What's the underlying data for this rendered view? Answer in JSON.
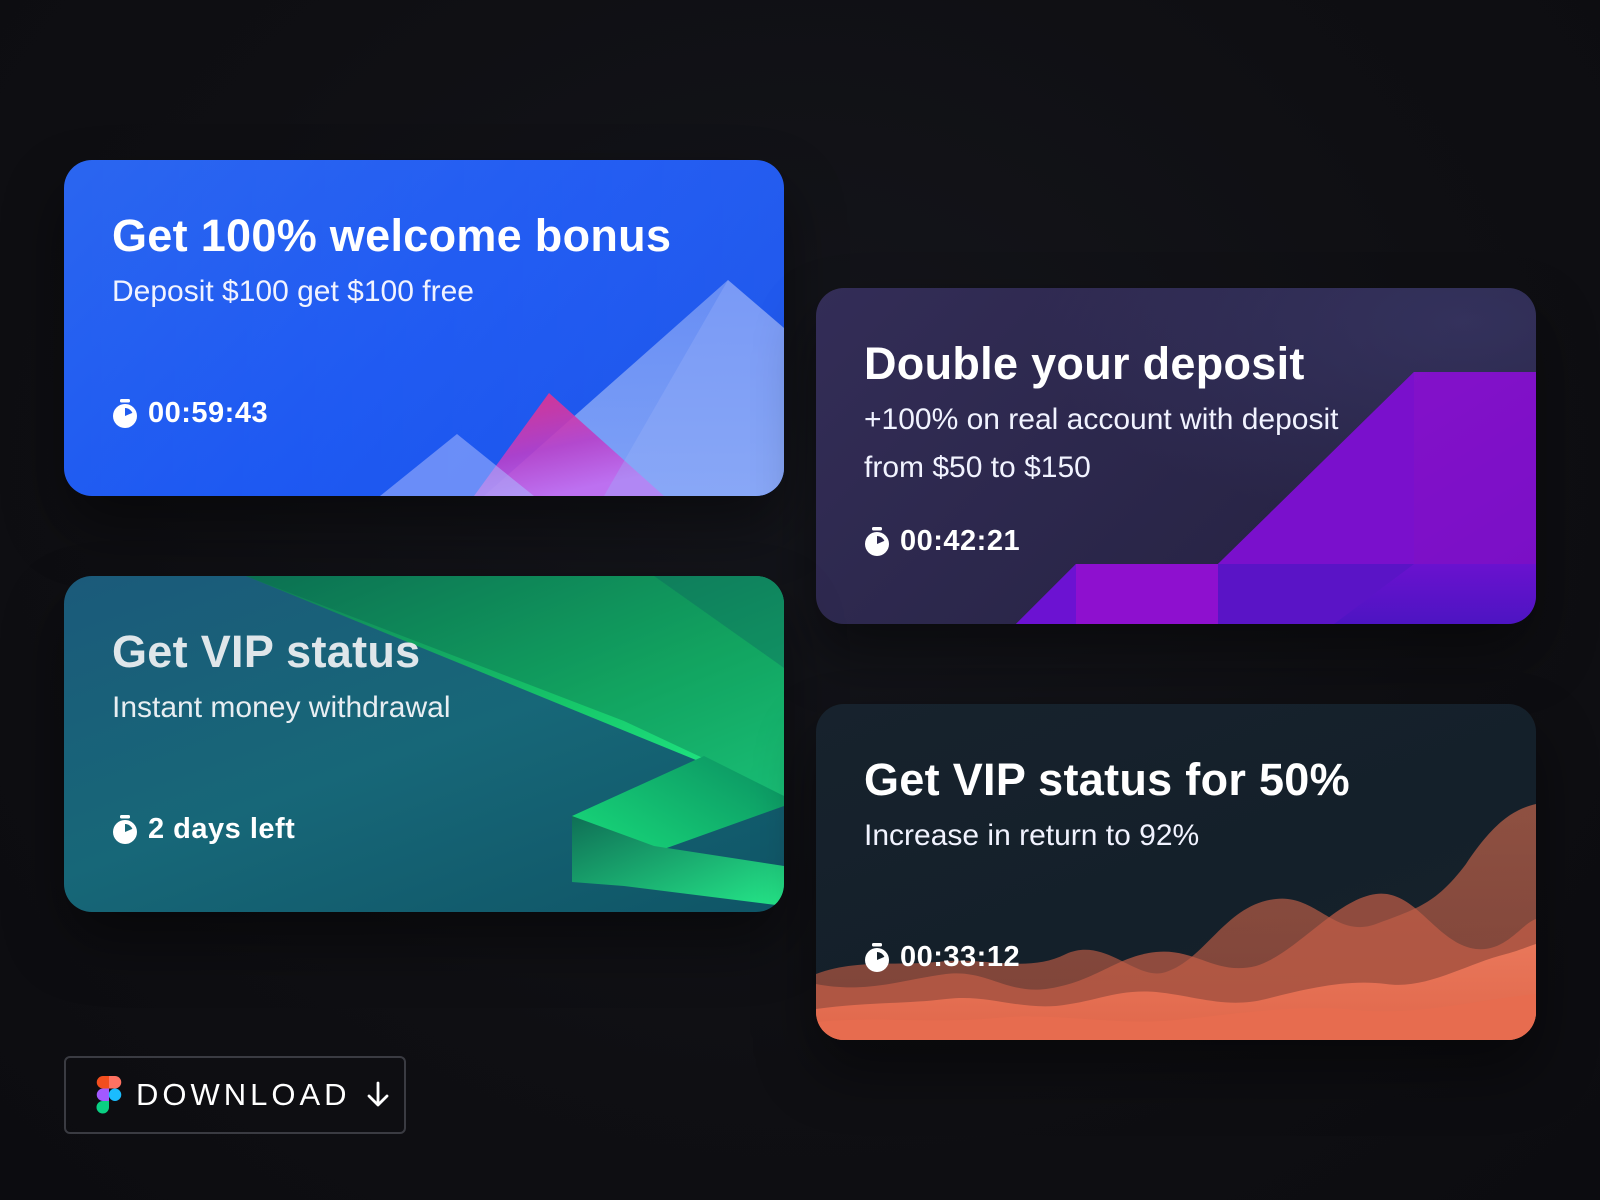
{
  "cards": [
    {
      "title": "Get 100% welcome bonus",
      "subtitle": "Deposit $100 get $100 free",
      "timer": "00:59:43",
      "icon": "stopwatch-icon",
      "colors": {
        "primary": "#1a56f2",
        "accent": "#e0338a"
      }
    },
    {
      "title": "Double your deposit",
      "subtitle_line1": "+100% on real account with deposit",
      "subtitle_line2": "from $50 to $150",
      "timer": "00:42:21",
      "icon": "stopwatch-icon",
      "colors": {
        "primary": "#2a2649",
        "accent": "#8a10c8"
      }
    },
    {
      "title": "Get VIP status",
      "subtitle": "Instant money withdrawal",
      "timer": "2 days left",
      "icon": "stopwatch-icon",
      "colors": {
        "primary": "#176778",
        "accent": "#1de27a"
      }
    },
    {
      "title": "Get VIP status for 50%",
      "subtitle": "Increase in return to 92%",
      "timer": "00:33:12",
      "icon": "stopwatch-icon",
      "colors": {
        "primary": "#14202a",
        "accent": "#e8704f"
      }
    }
  ],
  "download": {
    "label": "DOWNLOAD",
    "icon": "figma-logo-icon",
    "arrow_icon": "arrow-down-icon"
  }
}
